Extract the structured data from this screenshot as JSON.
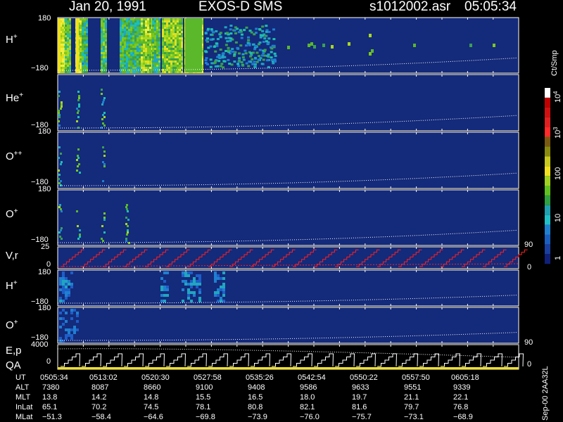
{
  "header": {
    "date": "Jan 20, 1991",
    "instrument": "EXOS-D SMS",
    "file": "s1012002.asr",
    "time": "05:05:34"
  },
  "panels": [
    {
      "id": "h",
      "label_base": "H",
      "label_sup": "+",
      "ytop": "180",
      "ybot": "−180"
    },
    {
      "id": "he",
      "label_base": "He",
      "label_sup": "+",
      "ytop": "180",
      "ybot": "−180"
    },
    {
      "id": "opp",
      "label_base": "O",
      "label_sup": "++",
      "ytop": "180",
      "ybot": "−180"
    },
    {
      "id": "op",
      "label_base": "O",
      "label_sup": "+",
      "ytop": "180",
      "ybot": "−180",
      "right_tick": "90"
    },
    {
      "id": "vr",
      "label_base": "V,r",
      "label_sup": "",
      "ytop": "25",
      "ybot": "0",
      "right_tick": "0"
    },
    {
      "id": "h2",
      "label_base": "H",
      "label_sup": "+",
      "ytop": "180",
      "ybot": "−180"
    },
    {
      "id": "o2",
      "label_base": "O",
      "label_sup": "+",
      "ytop": "180",
      "ybot": "−180",
      "right_tick": "90"
    },
    {
      "id": "ep",
      "label_base": "E,p",
      "label2": "QA",
      "ytop": "4000",
      "ybot": "0",
      "right_tick": "0"
    }
  ],
  "colorbar": {
    "unit": "Ct/Smp",
    "labels": [
      "10",
      "4",
      "10",
      "3",
      "100",
      "10",
      "1"
    ]
  },
  "footer": {
    "side_label": "Sep-00  2AA32L",
    "row_labels": [
      "UT",
      "ALT",
      "MLT",
      "InLat",
      "MLat"
    ],
    "columns": [
      [
        "0505:34",
        "7380",
        "13.8",
        "65.1",
        "−51.3"
      ],
      [
        "0513:02",
        "8087",
        "14.2",
        "70.2",
        "−58.4"
      ],
      [
        "0520:30",
        "8660",
        "14.8",
        "74.5",
        "−64.6"
      ],
      [
        "0527:58",
        "9100",
        "15.5",
        "78.1",
        "−69.8"
      ],
      [
        "0535:26",
        "9408",
        "16.5",
        "80.8",
        "−73.9"
      ],
      [
        "0542:54",
        "9586",
        "18.0",
        "82.1",
        "−76.0"
      ],
      [
        "0550:22",
        "9633",
        "19.7",
        "81.6",
        "−75.7"
      ],
      [
        "0557:50",
        "9551",
        "21.1",
        "79.7",
        "−73.1"
      ],
      [
        "0605:18",
        "9339",
        "22.1",
        "76.8",
        "−68.9"
      ]
    ]
  },
  "colors": {
    "background": "#000000",
    "panel": "#142a7a",
    "curve": "#ffffff",
    "stair_red": "#ff2020",
    "qa_yellow": "#f2e21a"
  },
  "chart_data": {
    "type": "heatmap",
    "x_labels": [
      "0505:34",
      "0513:02",
      "0520:30",
      "0527:58",
      "0535:26",
      "0542:54",
      "0550:22",
      "0557:50",
      "0605:18"
    ],
    "color_scale": {
      "unit": "Ct/Smp",
      "log": true,
      "range": [
        1,
        10000
      ]
    },
    "panels": [
      {
        "name": "H+",
        "ylim": [
          -180,
          180
        ]
      },
      {
        "name": "He+",
        "ylim": [
          -180,
          180
        ]
      },
      {
        "name": "O++",
        "ylim": [
          -180,
          180
        ]
      },
      {
        "name": "O+",
        "ylim": [
          -180,
          180
        ]
      },
      {
        "name": "V,r",
        "ylim": [
          0,
          25
        ]
      },
      {
        "name": "H+",
        "ylim": [
          -180,
          180
        ]
      },
      {
        "name": "O+",
        "ylim": [
          -180,
          180
        ]
      },
      {
        "name": "E,p",
        "ylim": [
          0,
          4000
        ]
      }
    ]
  }
}
